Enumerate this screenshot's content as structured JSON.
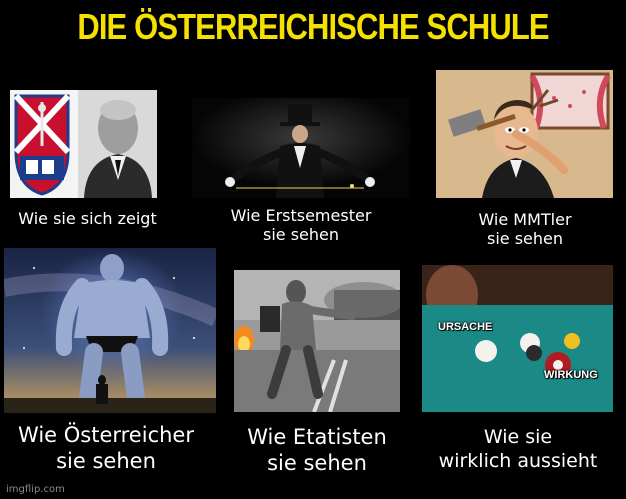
{
  "title": "DIE ÖSTERREICHISCHE SCHULE",
  "captions": {
    "top_left": "Wie sie sich zeigt",
    "top_middle_line1": "Wie Erstsemester",
    "top_middle_line2": "sie sehen",
    "top_right_line1": "Wie MMTler",
    "top_right_line2": "sie sehen",
    "bottom_left_line1": "Wie Österreicher",
    "bottom_left_line2": "sie sehen",
    "bottom_middle_line1": "Wie Etatisten",
    "bottom_middle_line2": "sie sehen",
    "bottom_right_line1": "Wie sie",
    "bottom_right_line2": "wirklich aussieht"
  },
  "panel_labels": {
    "ursache": "URSACHE",
    "wirkung": "WIRKUNG"
  },
  "watermark": "imgflip.com",
  "colors": {
    "title": "#f5e100",
    "background": "#000000",
    "caption": "#ffffff"
  }
}
